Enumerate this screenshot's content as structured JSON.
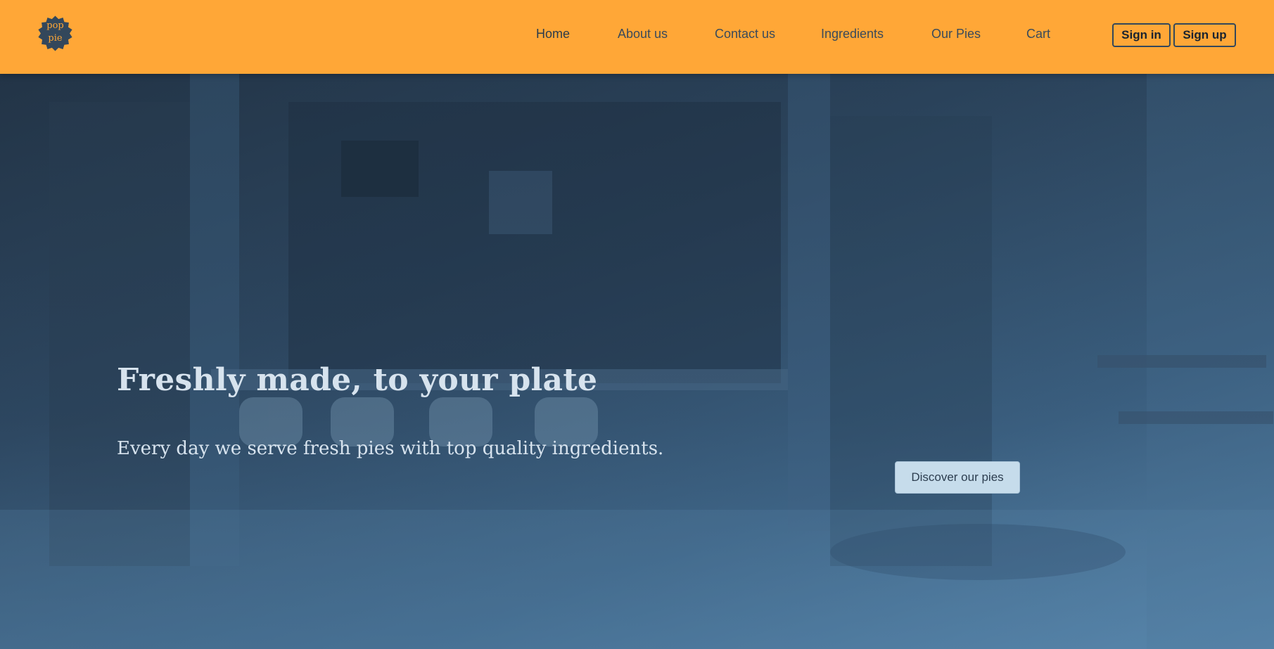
{
  "header": {
    "logo": {
      "line1": "pop",
      "line2": "pie",
      "icon": "badge-logo-icon"
    },
    "nav": [
      {
        "label": "Home",
        "active": true
      },
      {
        "label": "About us",
        "active": false
      },
      {
        "label": "Contact us",
        "active": false
      },
      {
        "label": "Ingredients",
        "active": false
      },
      {
        "label": "Our Pies",
        "active": false
      },
      {
        "label": "Cart",
        "active": false
      }
    ],
    "sign_in_label": "Sign in",
    "sign_up_label": "Sign up"
  },
  "hero": {
    "title": "Freshly made, to your plate",
    "subtitle": "Every day we serve fresh pies with top quality ingredients.",
    "cta_label": "Discover our pies"
  },
  "colors": {
    "header_bg": "#ffa737",
    "logo_badge": "#33475b",
    "hero_text": "#d7e3ee",
    "cta_bg": "#c6dceb"
  }
}
